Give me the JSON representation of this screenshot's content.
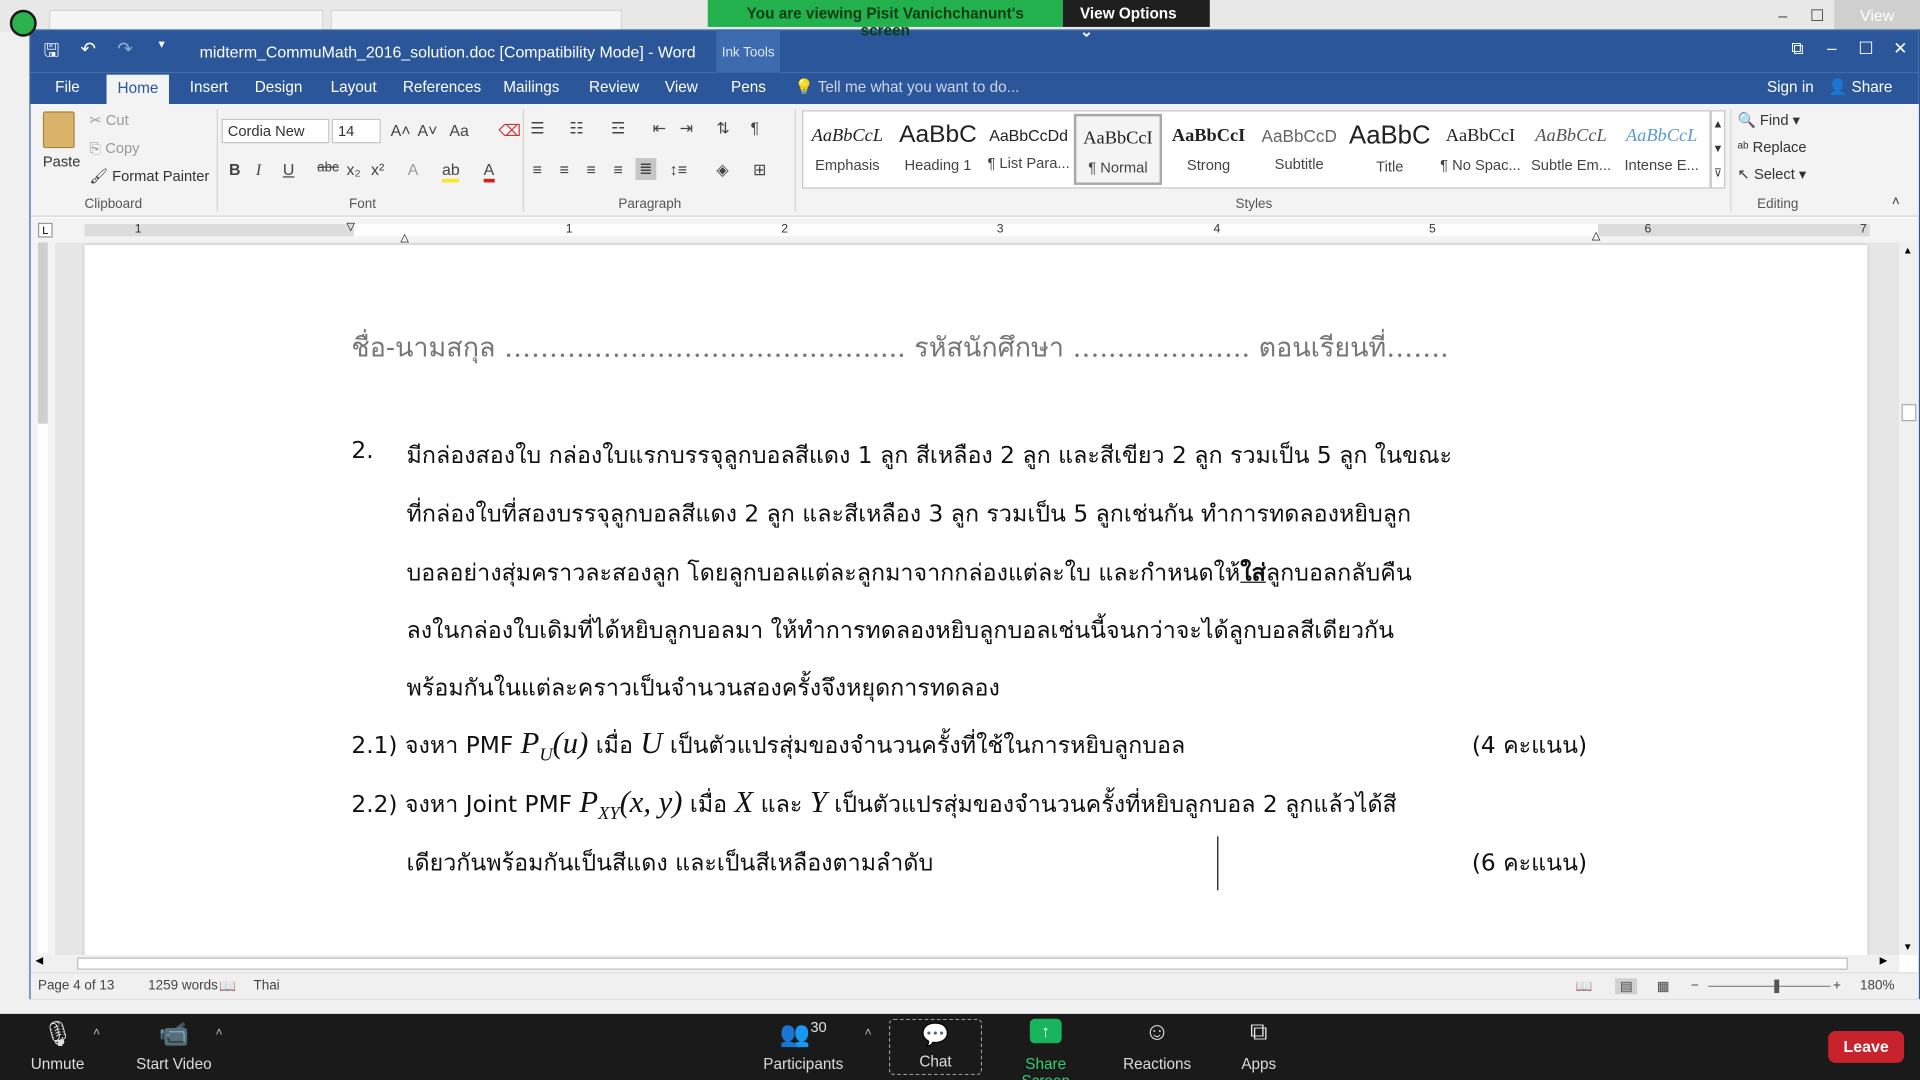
{
  "zoom_banner": {
    "viewing": "You are viewing Pisit Vanichchanunt's screen",
    "view_options": "View Options ⌄"
  },
  "bg_window": {
    "view_label": "View"
  },
  "word": {
    "title": "midterm_CommuMath_2016_solution.doc [Compatibility Mode] - Word",
    "ink_tools": "Ink Tools",
    "tabs": [
      "File",
      "Home",
      "Insert",
      "Design",
      "Layout",
      "References",
      "Mailings",
      "Review",
      "View",
      "Pens"
    ],
    "tell_me": "Tell me what you want to do...",
    "sign_in": "Sign in",
    "share": "Share"
  },
  "ribbon": {
    "clipboard": {
      "paste": "Paste",
      "cut": "Cut",
      "copy": "Copy",
      "format_painter": "Format Painter",
      "label": "Clipboard"
    },
    "font": {
      "name": "Cordia New",
      "size": "14",
      "label": "Font"
    },
    "paragraph": {
      "label": "Paragraph"
    },
    "styles": {
      "label": "Styles",
      "items": [
        {
          "sample": "AaBbCcL",
          "name": "Emphasis"
        },
        {
          "sample": "AaBbC",
          "name": "Heading 1"
        },
        {
          "sample": "AaBbCcDd",
          "name": "¶ List Para..."
        },
        {
          "sample": "AaBbCcI",
          "name": "¶ Normal"
        },
        {
          "sample": "AaBbCcI",
          "name": "Strong"
        },
        {
          "sample": "AaBbCcD",
          "name": "Subtitle"
        },
        {
          "sample": "AaBbC",
          "name": "Title"
        },
        {
          "sample": "AaBbCcI",
          "name": "¶ No Spac..."
        },
        {
          "sample": "AaBbCcL",
          "name": "Subtle Em..."
        },
        {
          "sample": "AaBbCcL",
          "name": "Intense E..."
        }
      ]
    },
    "editing": {
      "find": "Find",
      "replace": "Replace",
      "select": "Select",
      "label": "Editing"
    }
  },
  "ruler": {
    "numbers": [
      "1",
      "1",
      "2",
      "3",
      "4",
      "5",
      "6",
      "7"
    ]
  },
  "document": {
    "header_line": "ชื่อ-นามสกุล ……………………………..…….... รหัสนักศึกษา …..….……….. ตอนเรียนที่…….",
    "q_number": "2.",
    "q_lines": [
      "มีกล่องสองใบ กล่องใบแรกบรรจุลูกบอลสีแดง 1 ลูก สีเหลือง 2 ลูก และสีเขียว 2 ลูก รวมเป็น 5 ลูก ในขณะ",
      "ที่กล่องใบที่สองบรรจุลูกบอลสีแดง 2 ลูก และสีเหลือง 3 ลูก รวมเป็น 5 ลูกเช่นกัน ทำการทดลองหยิบลูก",
      "บอลอย่างสุ่มคราวละสองลูก โดยลูกบอลแต่ละลูกมาจากกล่องแต่ละใบ และกำหนดให้",
      "ลงในกล่องใบเดิมที่ได้หยิบลูกบอลมา ให้ทำการทดลองหยิบลูกบอลเช่นนี้จนกว่าจะได้ลูกบอลสีเดียวกัน",
      "พร้อมกันในแต่ละคราวเป็นจำนวนสองครั้งจึงหยุดการทดลอง"
    ],
    "q_line3_bold": "ใส่",
    "q_line3_end": "ลูกบอลกลับคืน",
    "sub1": {
      "num": "2.1)",
      "pre": "จงหา PMF",
      "math_p": "P",
      "math_sub": "U",
      "math_arg": "(u)",
      "when": "เมื่อ",
      "var": "U",
      "post": "เป็นตัวแปรสุ่มของจำนวนครั้งที่ใช้ในการหยิบลูกบอล",
      "points": "(4 คะแนน)"
    },
    "sub2": {
      "num": "2.2)",
      "pre": "จงหา Joint PMF",
      "math_p": "P",
      "math_sub": "XY",
      "math_arg": "(x, y)",
      "when": "เมื่อ",
      "var_x": "X",
      "and": "และ",
      "var_y": "Y",
      "post": "เป็นตัวแปรสุ่มของจำนวนครั้งที่หยิบลูกบอล 2 ลูกแล้วได้สี",
      "line2": "เดียวกันพร้อมกันเป็นสีแดง และเป็นสีเหลืองตามลำดับ",
      "points": "(6 คะแนน)"
    }
  },
  "status": {
    "page": "Page 4 of 13",
    "words": "1259 words",
    "language": "Thai",
    "zoom": "180%"
  },
  "zoom_bar": {
    "unmute": "Unmute",
    "start_video": "Start Video",
    "participants_count": "30",
    "participants": "Participants",
    "chat": "Chat",
    "share_screen": "Share Screen",
    "reactions": "Reactions",
    "apps": "Apps",
    "leave": "Leave"
  }
}
